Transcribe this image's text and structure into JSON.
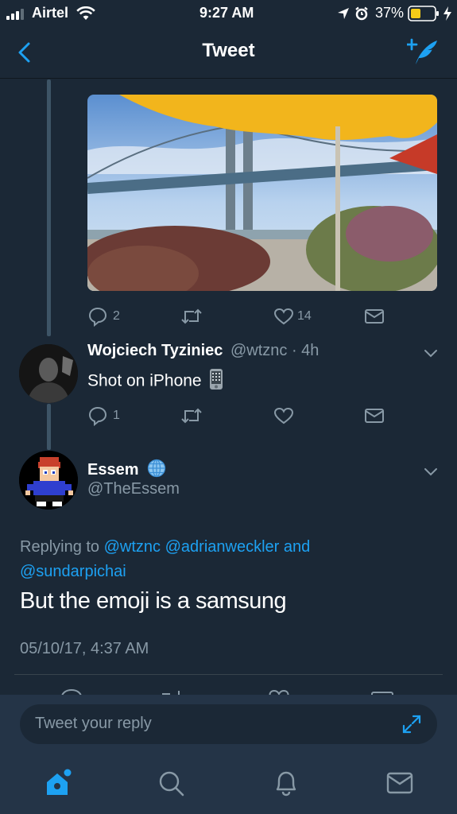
{
  "status_bar": {
    "carrier": "Airtel",
    "time": "9:27 AM",
    "battery": "37%"
  },
  "nav": {
    "title": "Tweet",
    "back_icon": "chevron-left-icon",
    "compose_icon": "compose-tweet-icon"
  },
  "parent_tweet": {
    "reply_count": "2",
    "like_count": "14"
  },
  "reply_tweet": {
    "name": "Wojciech Tyziniec",
    "handle_time": "@wtznc · 4h",
    "text": "Shot on iPhone",
    "emoji": "📱",
    "reply_count": "1"
  },
  "main_tweet": {
    "name": "Essem",
    "handle": "@TheEssem",
    "replying_prefix": "Replying to",
    "replying_line1": "@wtznc @adrianweckler and",
    "replying_line2": "@sundarpichai",
    "text": "But the emoji is a samsung",
    "timestamp": "05/10/17, 4:37 AM"
  },
  "reply_box": {
    "placeholder": "Tweet your reply"
  },
  "tabs": [
    "home-icon",
    "search-icon",
    "notifications-icon",
    "messages-icon"
  ],
  "colors": {
    "background": "#1b2836",
    "accent": "#1da1f2",
    "muted": "#8899a6"
  }
}
